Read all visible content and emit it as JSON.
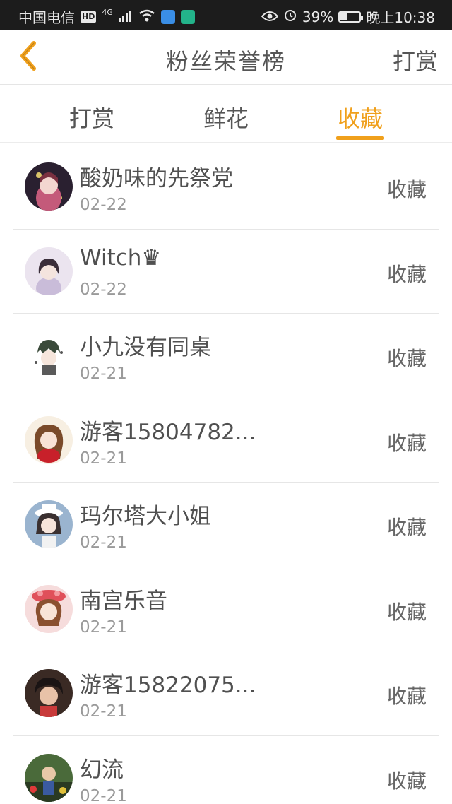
{
  "status_bar": {
    "carrier": "中国电信",
    "hd_badge": "HD",
    "network": "4G",
    "battery_text": "39%",
    "battery_level": 0.39,
    "time": "晚上10:38"
  },
  "header": {
    "title": "粉丝荣誉榜",
    "action_label": "打赏",
    "back_icon": "chevron-left-icon",
    "accent_color": "#f0a01c"
  },
  "tabs": [
    {
      "label": "打赏",
      "active": false
    },
    {
      "label": "鲜花",
      "active": false
    },
    {
      "label": "收藏",
      "active": true
    }
  ],
  "rows": [
    {
      "name": "酸奶味的先祭党",
      "date": "02-22",
      "action": "收藏"
    },
    {
      "name": "Witch♛",
      "date": "02-22",
      "action": "收藏"
    },
    {
      "name": "小九没有同桌",
      "date": "02-21",
      "action": "收藏"
    },
    {
      "name": "游客15804782...",
      "date": "02-21",
      "action": "收藏"
    },
    {
      "name": "玛尔塔大小姐",
      "date": "02-21",
      "action": "收藏"
    },
    {
      "name": "南宫乐音",
      "date": "02-21",
      "action": "收藏"
    },
    {
      "name": "游客15822075...",
      "date": "02-21",
      "action": "收藏"
    },
    {
      "name": "幻流",
      "date": "02-21",
      "action": "收藏"
    }
  ]
}
